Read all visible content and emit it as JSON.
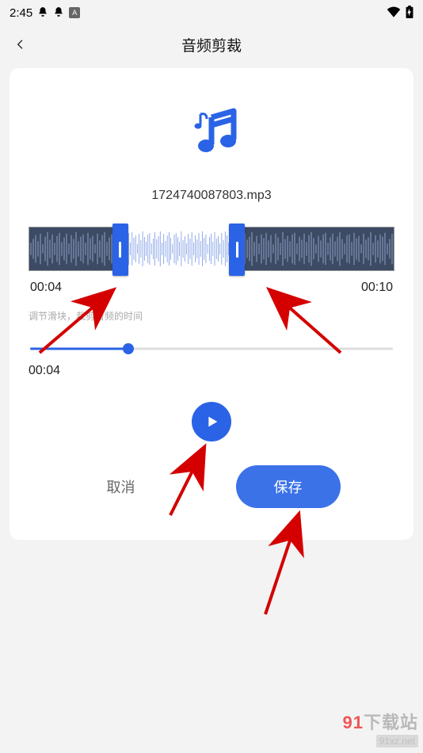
{
  "statusbar": {
    "time": "2:45"
  },
  "header": {
    "title": "音频剪裁"
  },
  "file": {
    "name": "1724740087803.mp3"
  },
  "trim": {
    "start_label": "00:04",
    "end_label": "00:10",
    "hint": "调节滑块，裁剪音频的时间",
    "handle_left_pct": 25,
    "handle_right_pct": 57
  },
  "playback": {
    "position_label": "00:04",
    "progress_pct": 27
  },
  "actions": {
    "cancel_label": "取消",
    "save_label": "保存"
  },
  "watermark": {
    "brand_num": "91",
    "brand_text": "下载站",
    "url": "91xz.net"
  },
  "colors": {
    "accent": "#2a63e6"
  }
}
